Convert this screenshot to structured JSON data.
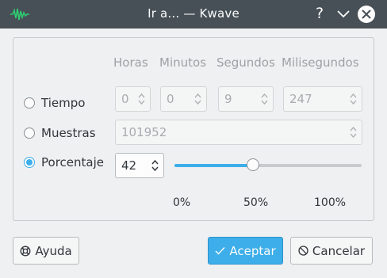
{
  "window": {
    "title": "Ir a... — Kwave",
    "help_glyph": "?"
  },
  "columns": {
    "hours": "Horas",
    "minutes": "Minutos",
    "seconds": "Segundos",
    "milliseconds": "Milisegundos"
  },
  "modes": {
    "time": {
      "label": "Tiempo",
      "checked": false
    },
    "samples": {
      "label": "Muestras",
      "checked": false
    },
    "percentage": {
      "label": "Porcentaje",
      "checked": true
    }
  },
  "time_fields": {
    "hours": "0",
    "minutes": "0",
    "seconds": "9",
    "milliseconds": "247"
  },
  "samples_value": "101952",
  "percentage": {
    "value": "42",
    "slider_level_percent": 42,
    "ticks": [
      "0%",
      "50%",
      "100%"
    ]
  },
  "buttons": {
    "help": "Ayuda",
    "accept": "Aceptar",
    "cancel": "Cancelar"
  },
  "colors": {
    "accent": "#3daee9",
    "titlebar": "#475057"
  },
  "icons": {
    "app": "kwave-waveform-icon",
    "help": "lifebuoy-icon",
    "accept": "checkmark-icon",
    "cancel": "cancel-circle-icon"
  }
}
